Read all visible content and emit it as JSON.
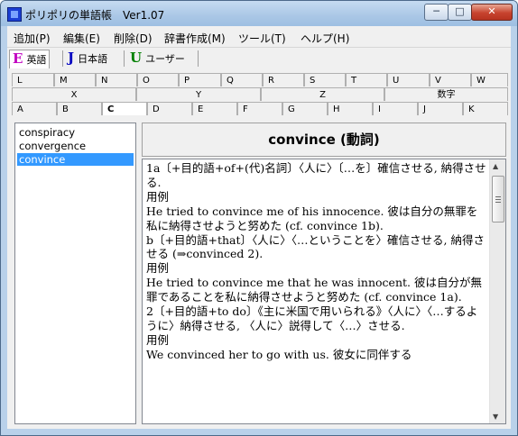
{
  "window": {
    "title": "ポリポリの単語帳　Ver1.07"
  },
  "menu": [
    "追加(P)",
    "編集(E)",
    "削除(D)",
    "辞書作成(M)",
    "ツール(T)",
    "ヘルプ(H)"
  ],
  "languages": [
    {
      "letter": "E",
      "label": "英語",
      "color": "#c000c0"
    },
    {
      "letter": "J",
      "label": "日本語",
      "color": "#0000c0"
    },
    {
      "letter": "U",
      "label": "ユーザー",
      "color": "#008000"
    }
  ],
  "tab_rows": {
    "row1": [
      "L",
      "M",
      "N",
      "O",
      "P",
      "Q",
      "R",
      "S",
      "T",
      "U",
      "V",
      "W"
    ],
    "row2": [
      "X",
      "Y",
      "Z",
      "数字"
    ],
    "row3": [
      "A",
      "B",
      "C",
      "D",
      "E",
      "F",
      "G",
      "H",
      "I",
      "J",
      "K"
    ]
  },
  "selected_tab": "C",
  "words": [
    "conspiracy",
    "convergence",
    "convince"
  ],
  "selected_word": "convince",
  "headword": "convince (動詞)",
  "definition": "1a〔+目的語+of+(代)名詞〕〈人に〉〔…を〕確信させる, 納得させる.\n用例\nHe tried to convince me of his innocence. 彼は自分の無罪を私に納得させようと努めた (cf. convince 1b).\nb〔+目的語+that〕〈人に〉〈…ということを〉確信させる, 納得させる (⇒convinced 2).\n用例\nHe tried to convince me that he was innocent. 彼は自分が無罪であることを私に納得させようと努めた (cf. convince 1a).\n2〔+目的語+to do〕《主に米国で用いられる》〈人に〉〈…するように〉納得させる, 〈人に〉説得して〈…〉させる.\n用例\nWe convinced her to go with us. 彼女に同伴する"
}
